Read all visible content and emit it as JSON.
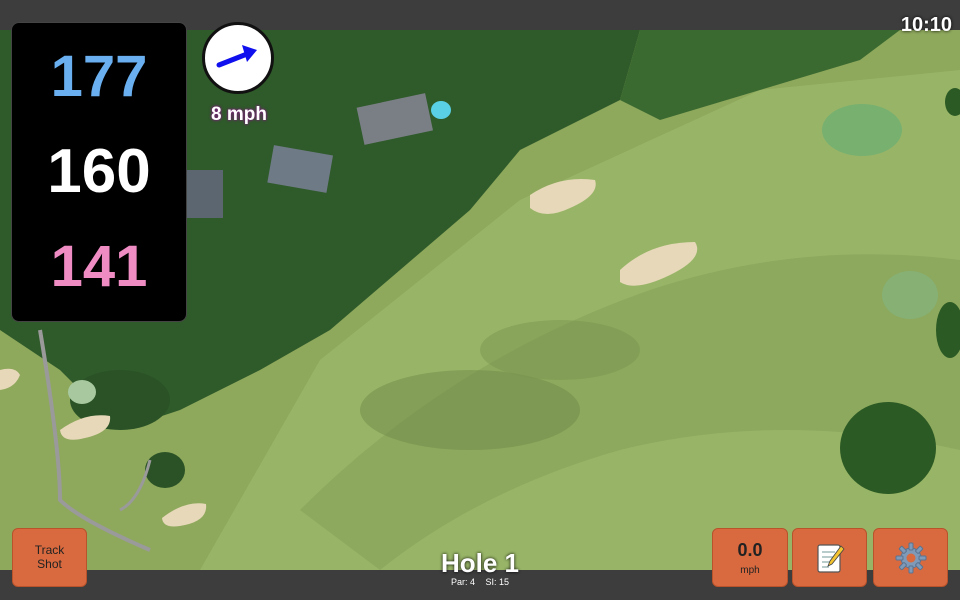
{
  "status_bar": {
    "time": "10:10"
  },
  "distances": {
    "back": "177",
    "center": "160",
    "front": "141"
  },
  "wind": {
    "speed": "8 mph",
    "direction_icon": "arrow-right-icon"
  },
  "buttons": {
    "track_shot_line1": "Track",
    "track_shot_line2": "Shot",
    "speed_value": "0.0",
    "speed_unit": "mph",
    "notes_icon": "notepad-icon",
    "settings_icon": "gear-icon"
  },
  "hole": {
    "title": "Hole 1",
    "par": "Par: 4",
    "si": "SI: 15"
  },
  "colors": {
    "back_distance": "#6ab0f0",
    "center_distance": "#ffffff",
    "front_distance": "#f08cc4",
    "button_accent": "#d96a3f"
  }
}
